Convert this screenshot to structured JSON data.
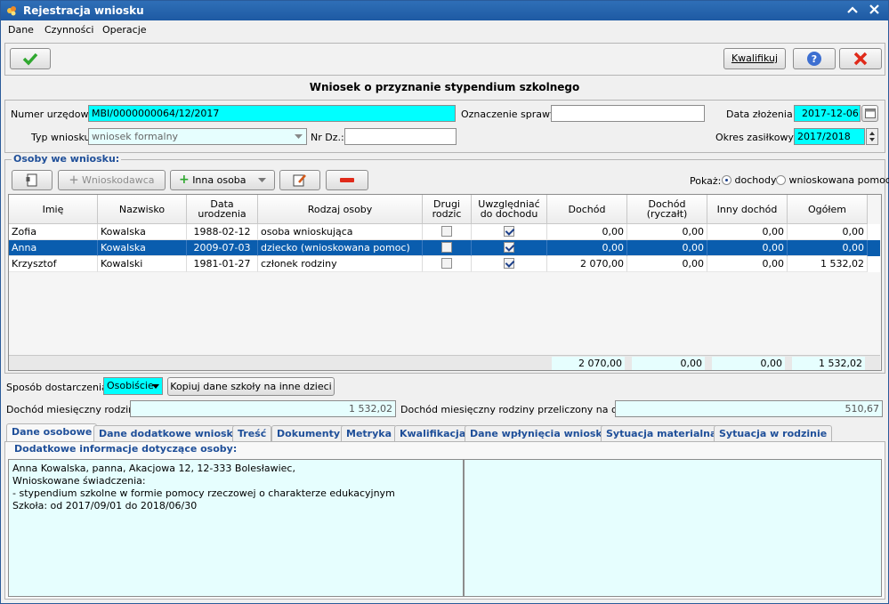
{
  "window": {
    "title": "Rejestracja wniosku",
    "minimize_glyph": "⌃",
    "close_glyph": "✕"
  },
  "menu": [
    "Dane",
    "Czynności",
    "Operacje"
  ],
  "toolbar": {
    "ok_icon": "check-icon",
    "qualify_label": "Kwalifikuj",
    "help_label": "?",
    "cancel_label": "✕"
  },
  "form": {
    "heading": "Wniosek o przyznanie stypendium szkolnego",
    "official_number_label": "Numer urzędowy:",
    "official_number_value": "MBI/0000000064/12/2017",
    "case_mark_label": "Oznaczenie sprawy:",
    "case_mark_value": "",
    "submit_date_label": "Data złożenia:",
    "submit_date_value": "2017-12-06",
    "type_label": "Typ wniosku:",
    "type_value": "wniosek formalny",
    "nr_dz_label": "Nr Dz.:",
    "nr_dz_value": "",
    "period_label": "Okres zasiłkowy:",
    "period_value": "2017/2018"
  },
  "persons": {
    "section_title": "Osoby we wniosku:",
    "btn_applicant": "Wnioskodawca",
    "btn_other": "Inna osoba",
    "show_label": "Pokaż:",
    "radio_income": "dochody",
    "radio_aid": "wnioskowana pomoc",
    "columns": [
      "Imię",
      "Nazwisko",
      "Data urodzenia",
      "Rodzaj osoby",
      "Drugi rodzic",
      "Uwzględniać do dochodu",
      "Dochód",
      "Dochód (ryczałt)",
      "Inny dochód",
      "Ogółem"
    ],
    "rows": [
      {
        "first": "Zofia",
        "last": "Kowalska",
        "birth": "1988-02-12",
        "kind": "osoba wnioskująca",
        "second_parent": false,
        "include": true,
        "income": "0,00",
        "lump": "0,00",
        "other": "0,00",
        "total": "0,00"
      },
      {
        "first": "Anna",
        "last": "Kowalska",
        "birth": "2009-07-03",
        "kind": "dziecko (wnioskowana pomoc)",
        "second_parent": false,
        "include": true,
        "income": "0,00",
        "lump": "0,00",
        "other": "0,00",
        "total": "0,00"
      },
      {
        "first": "Krzysztof",
        "last": "Kowalski",
        "birth": "1981-01-27",
        "kind": "członek rodziny",
        "second_parent": false,
        "include": true,
        "income": "2 070,00",
        "lump": "0,00",
        "other": "0,00",
        "total": "1 532,02"
      }
    ],
    "selected_row": 1,
    "totals": {
      "income": "2 070,00",
      "lump": "0,00",
      "other": "0,00",
      "total": "1 532,02"
    }
  },
  "delivery": {
    "label": "Sposób dostarczenia:",
    "value": "Osobiście",
    "copy_button": "Kopiuj dane szkoły na inne dzieci"
  },
  "income_summary": {
    "family_label": "Dochód miesięczny rodziny:",
    "family_value": "1 532,02",
    "per_person_label": "Dochód miesięczny rodziny przeliczony na osobę:",
    "per_person_value": "510,67"
  },
  "tabs": [
    "Dane osobowe",
    "Dane dodatkowe wniosku",
    "Treść",
    "Dokumenty",
    "Metryka",
    "Kwalifikacja",
    "Dane wpłynięcia wniosku",
    "Sytuacja materialna",
    "Sytuacja w rodzinie"
  ],
  "active_tab": 0,
  "details": {
    "title": "Dodatkowe informacje dotyczące osoby:",
    "lines": [
      "Anna Kowalska, panna, Akacjowa 12, 12-333 Bolesławiec,",
      "Wnioskowane świadczenia:",
      "- stypendium szkolne w formie pomocy rzeczowej o charakterze edukacyjnym",
      "Szkoła: od 2017/09/01 do 2018/06/30"
    ]
  },
  "colors": {
    "accent": "#1f4f99",
    "selection": "#0a5dae",
    "cyan_field": "#00ffff",
    "light_cyan": "#e6fefe",
    "titlebar": "#1e5aa3"
  }
}
